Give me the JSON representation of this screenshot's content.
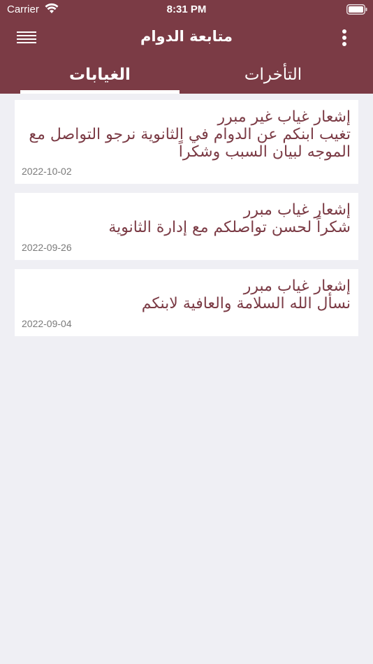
{
  "status": {
    "carrier": "Carrier",
    "time": "8:31 PM"
  },
  "navbar": {
    "title": "متابعة الدوام"
  },
  "tabs": [
    {
      "label": "الغيابات",
      "selected": true
    },
    {
      "label": "التأخرات",
      "selected": false
    }
  ],
  "notifications": [
    {
      "text": "إشعار غياب غير مبرر\nتغيب ابنكم عن الدوام في الثانوية نرجو التواصل مع الموجه لبيان السبب وشكراً",
      "date": "2022-10-02"
    },
    {
      "text": "إشعار غياب  مبرر\nشكراً لحسن تواصلكم مع إدارة الثانوية",
      "date": "2022-09-26"
    },
    {
      "text": "إشعار غياب  مبرر\nنسأل الله السلامة والعافية لابنكم",
      "date": "2022-09-04"
    }
  ],
  "colors": {
    "primary": "#7b3b45",
    "background": "#efeff4",
    "card": "#ffffff",
    "date": "#7a7a7a"
  }
}
